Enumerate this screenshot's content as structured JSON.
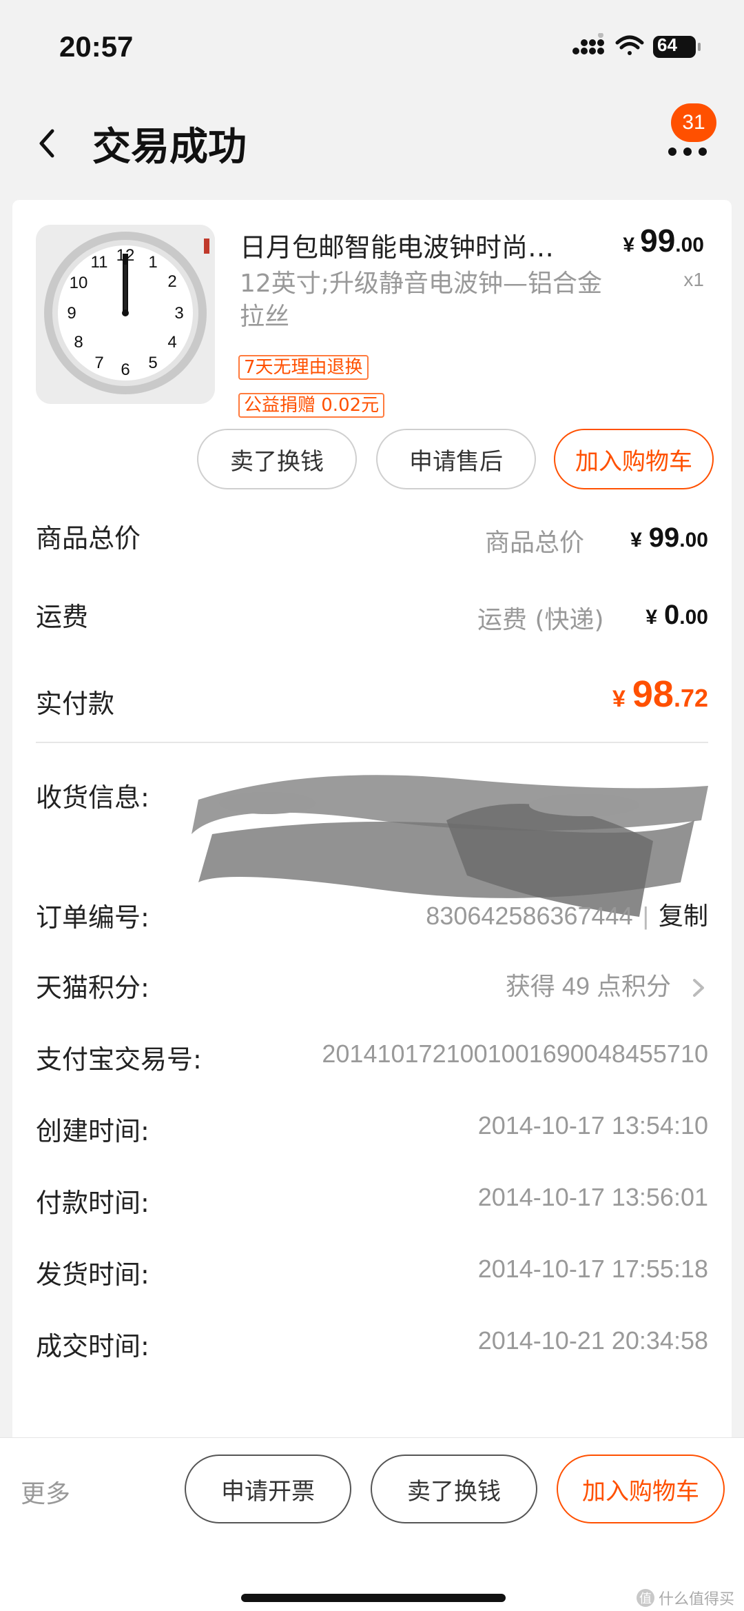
{
  "status_bar": {
    "time": "20:57",
    "battery": "64"
  },
  "nav": {
    "title": "交易成功",
    "badge_count": "31"
  },
  "item": {
    "title": "日月包邮智能电波钟时尚…",
    "spec": "12英寸;升级静音电波钟—铝合金拉丝",
    "price_currency": "¥",
    "price_int": "99",
    "price_dec": ".00",
    "quantity": "x1",
    "tag_return": "7天无理由退换",
    "tag_charity": "公益捐赠 0.02元"
  },
  "item_actions": {
    "sell": "卖了换钱",
    "after_sale": "申请售后",
    "add_cart": "加入购物车"
  },
  "summary": {
    "goods_total_label": "商品总价",
    "goods_total_sub": "商品总价",
    "goods_total_int": "99",
    "goods_total_dec": ".00",
    "shipping_label": "运费",
    "shipping_sub": "运费 (快递)",
    "shipping_int": "0",
    "shipping_dec": ".00",
    "paid_label": "实付款",
    "paid_int": "98",
    "paid_dec": ".72",
    "currency": "¥"
  },
  "details": {
    "address_label": "收货信息:",
    "order_no_label": "订单编号:",
    "order_no": "830642586367444",
    "copy": "复制",
    "copy_sep": "|",
    "points_label": "天猫积分:",
    "points_value": "获得 49 点积分",
    "alipay_label": "支付宝交易号:",
    "alipay_no": "2014101721001001690048455710",
    "created_label": "创建时间:",
    "created": "2014-10-17 13:54:10",
    "paid_time_label": "付款时间:",
    "paid_time": "2014-10-17 13:56:01",
    "shipped_label": "发货时间:",
    "shipped": "2014-10-17 17:55:18",
    "done_label": "成交时间:",
    "done": "2014-10-21 20:34:58"
  },
  "bottom_bar": {
    "more": "更多",
    "invoice": "申请开票",
    "sell": "卖了换钱",
    "add_cart": "加入购物车"
  },
  "watermark": {
    "icon_text": "值",
    "text": "什么值得买"
  },
  "colors": {
    "accent": "#ff5000",
    "muted": "#999999"
  }
}
